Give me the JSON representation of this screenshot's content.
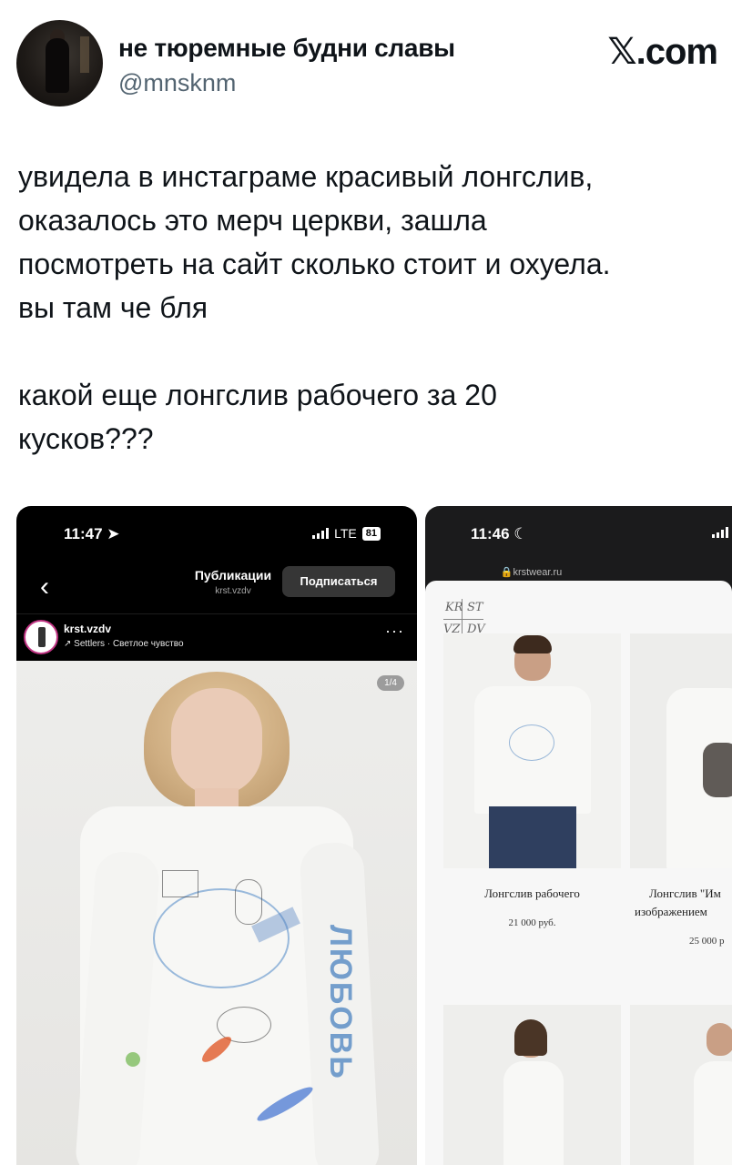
{
  "tweet": {
    "author_name": "не тюремные будни славы",
    "author_handle": "@mnsknm",
    "brand": "𝕏.com",
    "text": "увидела в инстаграме красивый лонгслив,\nоказалось это мерч церкви, зашла\nпосмотреть на сайт сколько стоит и охуела.\nвы там че бля\n\nкакой еще лонгслив рабочего за 20\nкусков???"
  },
  "instagram": {
    "status_time": "11:47",
    "network": "LTE",
    "battery": "81",
    "nav_title": "Публикации",
    "nav_subtitle": "krst.vzdv",
    "follow_label": "Подписаться",
    "post_account": "krst.vzdv",
    "post_music": "↗ Settlers · Светлое чувство",
    "more_label": "···",
    "counter": "1/4",
    "sleeve_text": "ЛЮБОВЬ"
  },
  "shop": {
    "status_time": "11:46",
    "url": "krstwear.ru",
    "logo_lines": [
      "KR",
      "ST",
      "VZ",
      "DV"
    ],
    "products": [
      {
        "name": "Лонгслив рабочего",
        "price": "21 000 руб."
      },
      {
        "name": "Лонгслив \"Им",
        "name_line2": "изображением",
        "price": "25 000 р"
      }
    ]
  }
}
